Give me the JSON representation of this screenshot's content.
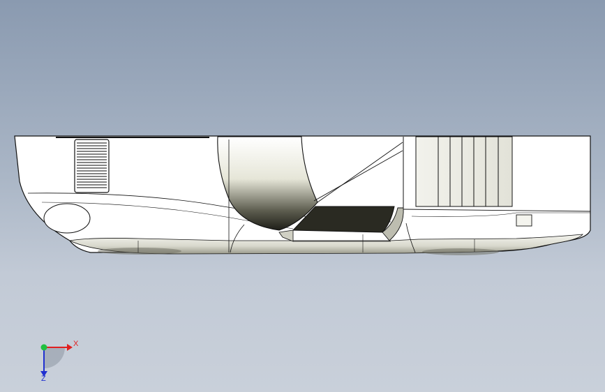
{
  "viewport": {
    "background_top": "#8a9ab0",
    "background_bottom": "#c9d0da"
  },
  "model": {
    "body_color": "#ffffff",
    "outline_color": "#111111",
    "grille_color": "#3a3a3a",
    "window_color": "#2a2a22"
  },
  "triad": {
    "x_label": "X",
    "z_label": "Z",
    "x_color": "#e02020",
    "y_color": "#20c040",
    "z_color": "#2030d0"
  }
}
